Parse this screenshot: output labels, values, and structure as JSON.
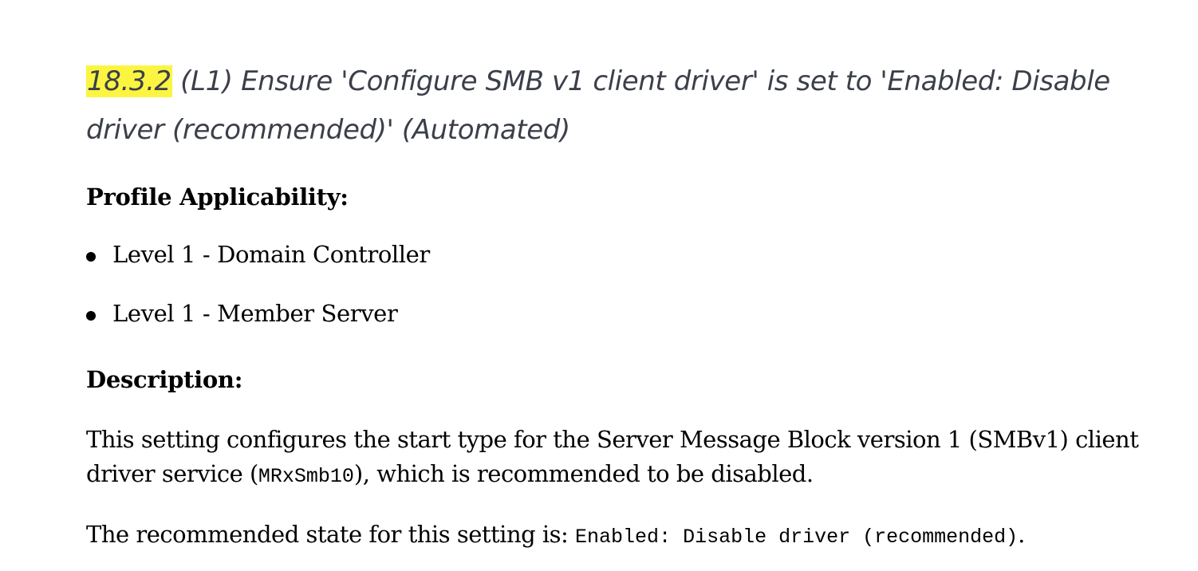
{
  "title": {
    "section_number": "18.3.2",
    "text": "(L1) Ensure 'Configure SMB v1 client driver' is set to 'Enabled: Disable driver (recommended)' (Automated)"
  },
  "profile": {
    "heading": "Profile Applicability:",
    "items": [
      {
        "label": "Level 1 - Domain Controller"
      },
      {
        "label": "Level 1 - Member Server"
      }
    ]
  },
  "description": {
    "heading": "Description:",
    "para1_before": "This setting configures the start type for the Server Message Block version 1 (SMBv1) client driver service (",
    "para1_code": "MRxSmb10",
    "para1_after": "), which is recommended to be disabled.",
    "para2_before": "The recommended state for this setting is: ",
    "para2_code": "Enabled: Disable driver (recommended)",
    "para2_after": "."
  },
  "colors": {
    "highlight": "#fbf542",
    "title_text": "#3b3f4a",
    "body_text": "#000000"
  }
}
